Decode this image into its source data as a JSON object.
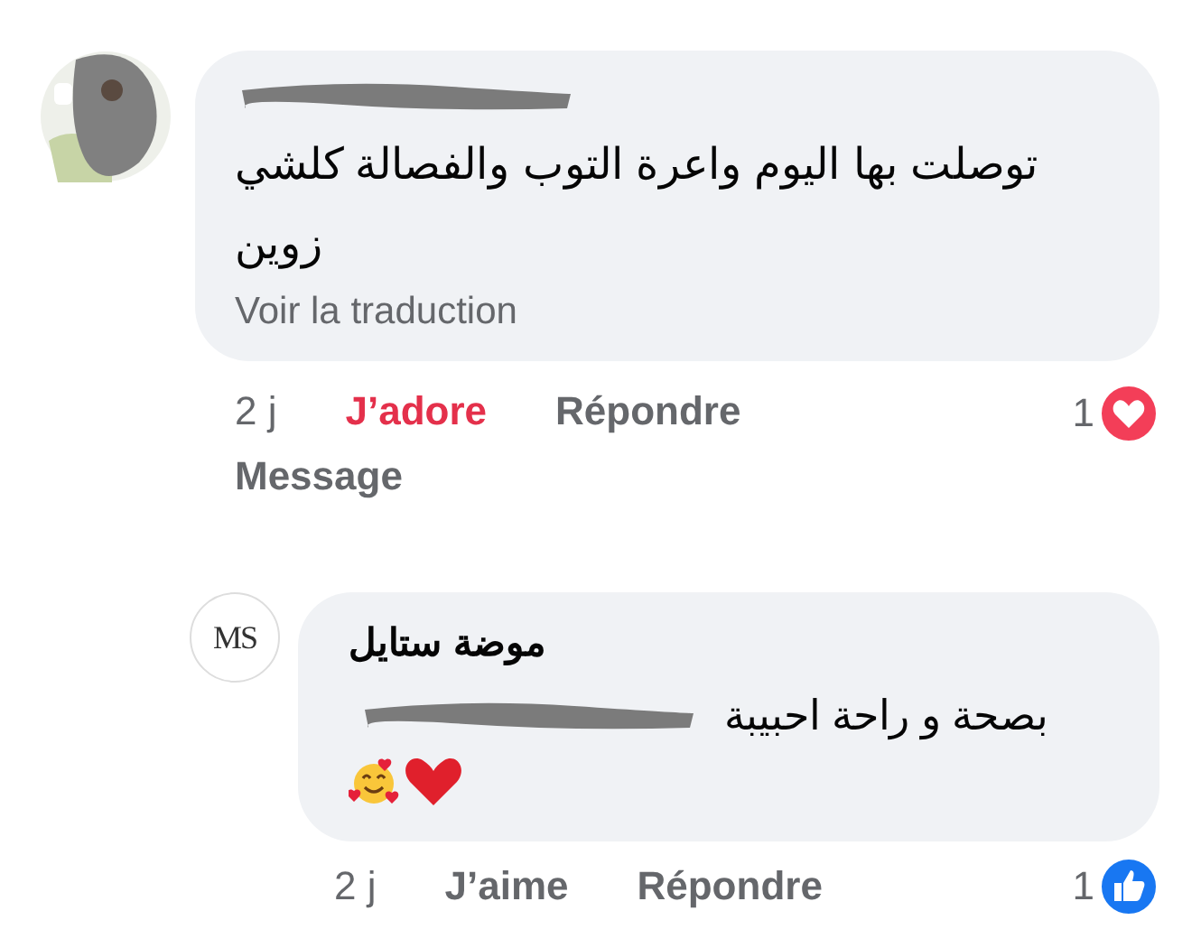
{
  "comments": [
    {
      "kind": "comment",
      "author_redacted": true,
      "text": "توصلت بها اليوم واعرة التوب والفصالة كلشي زوين",
      "translate_link": "Voir la traduction",
      "time": "2 j",
      "react_label": "J’adore",
      "reacted": true,
      "reaction": {
        "kind": "love"
      },
      "reply_label": "Répondre",
      "extra_action": "Message",
      "reaction_count": "1"
    },
    {
      "kind": "reply",
      "avatar": {
        "kind": "logo",
        "text": "MS"
      },
      "author": "موضة ستايل",
      "mention_redacted": true,
      "text": "بصحة و راحة احبيبة",
      "emojis": [
        {
          "kind": "smiling-face-with-hearts"
        },
        {
          "kind": "red-heart"
        }
      ],
      "time": "2 j",
      "react_label": "J’aime",
      "reacted": false,
      "reaction": {
        "kind": "like"
      },
      "reply_label": "Répondre",
      "reaction_count": "1"
    }
  ]
}
